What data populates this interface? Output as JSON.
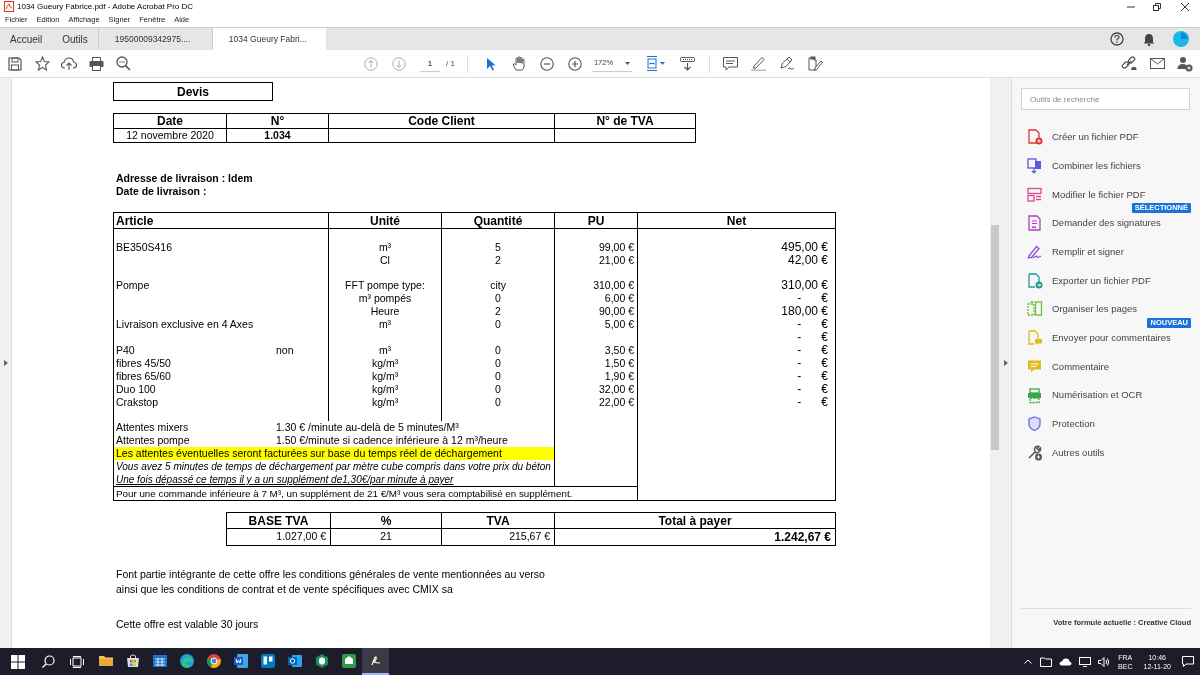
{
  "window": {
    "title": "1034 Gueury Fabrice.pdf - Adobe Acrobat Pro DC"
  },
  "menu": [
    "Fichier",
    "Edition",
    "Affichage",
    "Signer",
    "Fenêtre",
    "Aide"
  ],
  "tabs": [
    {
      "label": "Accueil",
      "kind": "nav",
      "selected": false
    },
    {
      "label": "Outils",
      "kind": "nav",
      "selected": false
    },
    {
      "label": "19500009342975....",
      "kind": "document",
      "selected": false
    },
    {
      "label": "1034 Gueury Fabri...",
      "kind": "document",
      "selected": true
    }
  ],
  "toolbar": {
    "page_current": "1",
    "page_total": "/ 1",
    "zoom": "172%"
  },
  "document": {
    "title": "Devis",
    "header_table": {
      "columns": [
        "Date",
        "N°",
        "Code Client",
        "N° de TVA"
      ],
      "cells": [
        "12 novembre 2020",
        "1.034"
      ]
    },
    "delivery": [
      "Adresse de livraison : Idem",
      "Date de livraison :"
    ],
    "lines_table": {
      "columns": [
        "Article",
        "Unité",
        "Quantité",
        "PU",
        "Net"
      ],
      "rows": [
        {
          "kind": "spacer"
        },
        {
          "kind": "item",
          "article": "BE350S416",
          "unit": "m³",
          "quantity": "5",
          "pu": "99,00 €",
          "net": "495,00 €"
        },
        {
          "kind": "item",
          "unit": "Cl",
          "quantity": "2",
          "pu": "21,00 €",
          "net": "42,00 €"
        },
        {
          "kind": "spacer"
        },
        {
          "kind": "item",
          "article": "Pompe",
          "unit": "FFT pompe type:",
          "quantity": "city",
          "pu": "310,00 €",
          "net": "310,00 €"
        },
        {
          "kind": "item",
          "unit": "m³ pompés",
          "quantity": "0",
          "pu": "6,00 €",
          "net": "-      €"
        },
        {
          "kind": "item",
          "unit": "Heure",
          "quantity": "2",
          "pu": "90,00 €",
          "net": "180,00 €"
        },
        {
          "kind": "item",
          "article": "Livraison exclusive en 4 Axes",
          "unit": "m³",
          "quantity": "0",
          "pu": "5,00 €",
          "net": "-      €"
        },
        {
          "kind": "item",
          "net": "-      €"
        },
        {
          "kind": "item",
          "article": "P40",
          "option": "non",
          "unit": "m³",
          "quantity": "0",
          "pu": "3,50 €",
          "net": "-      €"
        },
        {
          "kind": "item",
          "article": "fibres 45/50",
          "unit": "kg/m³",
          "quantity": "0",
          "pu": "1,50 €",
          "net": "-      €"
        },
        {
          "kind": "item",
          "article": "fibres 65/60",
          "unit": "kg/m³",
          "quantity": "0",
          "pu": "1,90 €",
          "net": "-      €"
        },
        {
          "kind": "item",
          "article": "Duo 100",
          "unit": "kg/m³",
          "quantity": "0",
          "pu": "32,00 €",
          "net": "-      €"
        },
        {
          "kind": "item",
          "article": "Crakstop",
          "unit": "kg/m³",
          "quantity": "0",
          "pu": "22,00 €",
          "net": "-      €"
        },
        {
          "kind": "spacer"
        }
      ],
      "notes": [
        {
          "kind": "label_value",
          "label": "Attentes mixers",
          "value": "1.30 € /minute au-delà de 5 minutes/M³"
        },
        {
          "kind": "label_value",
          "label": "Attentes pompe",
          "value": "1.50 €/minute si cadence inférieure à 12 m³/heure"
        },
        {
          "kind": "highlight",
          "text": "Les attentes éventuelles seront facturées sur base du temps réel de déchargement"
        },
        {
          "kind": "italic",
          "text": "Vous avez 5 minutes de temps de déchargement par mètre cube compris dans votre prix du béton"
        },
        {
          "kind": "italic_underline",
          "text": "Une fois dépassé ce temps il y a un supplément de1,30€/par minute à payer"
        },
        {
          "kind": "plain",
          "text": "Pour une commande inférieure à 7 M³, un supplément de 21 €/M³ vous sera comptabilisé en supplément."
        }
      ]
    },
    "totals_table": {
      "columns": [
        "BASE TVA",
        "%",
        "TVA",
        "Total à payer"
      ],
      "cells": [
        "1.027,00 €",
        "21",
        "215,67 €",
        "1.242,67 €"
      ]
    },
    "footer_paragraphs": [
      [
        "Font partie intégrante de cette offre les conditions générales de vente mentionnées au verso",
        "ainsi que les conditions de contrat et de vente spécifiques avec CMIX sa"
      ],
      [
        "Cette offre est valable 30 jours"
      ]
    ]
  },
  "tools_panel": {
    "search": {
      "placeholder": "Outils de recherche"
    },
    "tools": [
      {
        "label": "Créer un fichier PDF"
      },
      {
        "label": "Combiner les fichiers"
      },
      {
        "label": "Modifier le fichier PDF"
      },
      {
        "label": "Demander des signatures",
        "badge": "SÉLECTIONNÉ"
      },
      {
        "label": "Remplir et signer"
      },
      {
        "label": "Exporter un fichier PDF"
      },
      {
        "label": "Organiser les pages"
      },
      {
        "label": "Envoyer pour commentaires",
        "badge": "NOUVEAU"
      },
      {
        "label": "Commentaire"
      },
      {
        "label": "Numérisation et OCR"
      },
      {
        "label": "Protection"
      },
      {
        "label": "Autres outils"
      }
    ],
    "plan": "Votre formule actuelle : Creative Cloud"
  },
  "taskbar": {
    "apps": [
      {
        "selected": false
      },
      {
        "selected": false
      },
      {
        "selected": false
      },
      {
        "selected": false
      },
      {
        "selected": false
      },
      {
        "selected": false
      },
      {
        "selected": false
      },
      {
        "selected": false
      },
      {
        "selected": false
      },
      {
        "selected": false
      },
      {
        "selected": true
      }
    ],
    "language": "FRA",
    "layout": "BEC",
    "time": "10:46",
    "date": "12-11-20"
  }
}
